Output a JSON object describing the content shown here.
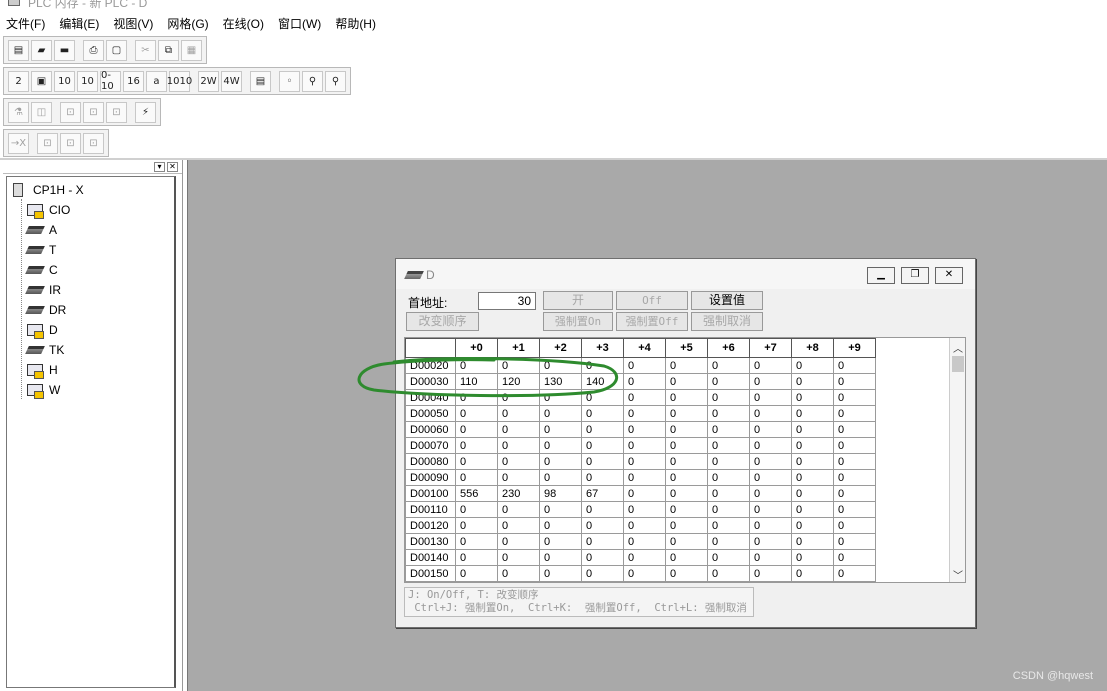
{
  "titlebar": {
    "title": "PLC 内存 - 新 PLC - D"
  },
  "menubar": {
    "items": [
      "文件(F)",
      "编辑(E)",
      "视图(V)",
      "网格(G)",
      "在线(O)",
      "窗口(W)",
      "帮助(H)"
    ]
  },
  "toolbar": {
    "row1": [
      "▤",
      "▰",
      "▬",
      "⎙",
      "▢",
      "✂",
      "⧉",
      "▦"
    ],
    "row2": [
      "2",
      "▣",
      "10",
      "10",
      "0-10",
      "16",
      "a",
      "1010",
      "2W",
      "4W",
      "▤",
      "◦",
      "⚲",
      "⚲"
    ],
    "row3": [
      "⚗",
      "◫",
      "⊡",
      "⊡",
      "⊡",
      "⚡"
    ],
    "row4": [
      "→X",
      "⊡",
      "⊡",
      "⊡"
    ]
  },
  "tree": {
    "root": "CP1H - X",
    "items": [
      {
        "label": "CIO",
        "icon": "memory"
      },
      {
        "label": "A",
        "icon": "chip"
      },
      {
        "label": "T",
        "icon": "chip"
      },
      {
        "label": "C",
        "icon": "chip"
      },
      {
        "label": "IR",
        "icon": "chip"
      },
      {
        "label": "DR",
        "icon": "chip"
      },
      {
        "label": "D",
        "icon": "memory"
      },
      {
        "label": "TK",
        "icon": "chip"
      },
      {
        "label": "H",
        "icon": "memory"
      },
      {
        "label": "W",
        "icon": "memory"
      }
    ]
  },
  "memory_window": {
    "title": "D",
    "start_address_label": "首地址:",
    "start_address_value": "30",
    "buttons": {
      "on": "开",
      "off": "Off",
      "set_value": "设置值",
      "change_order": "改变顺序",
      "force_on": "强制置On",
      "force_off": "强制置Off",
      "force_cancel": "强制取消"
    },
    "columns": [
      "+0",
      "+1",
      "+2",
      "+3",
      "+4",
      "+5",
      "+6",
      "+7",
      "+8",
      "+9"
    ],
    "rows": [
      {
        "addr": "D00020",
        "values": [
          "0",
          "0",
          "0",
          "0",
          "0",
          "0",
          "0",
          "0",
          "0",
          "0"
        ]
      },
      {
        "addr": "D00030",
        "values": [
          "110",
          "120",
          "130",
          "140",
          "0",
          "0",
          "0",
          "0",
          "0",
          "0"
        ]
      },
      {
        "addr": "D00040",
        "values": [
          "0",
          "0",
          "0",
          "0",
          "0",
          "0",
          "0",
          "0",
          "0",
          "0"
        ]
      },
      {
        "addr": "D00050",
        "values": [
          "0",
          "0",
          "0",
          "0",
          "0",
          "0",
          "0",
          "0",
          "0",
          "0"
        ]
      },
      {
        "addr": "D00060",
        "values": [
          "0",
          "0",
          "0",
          "0",
          "0",
          "0",
          "0",
          "0",
          "0",
          "0"
        ]
      },
      {
        "addr": "D00070",
        "values": [
          "0",
          "0",
          "0",
          "0",
          "0",
          "0",
          "0",
          "0",
          "0",
          "0"
        ]
      },
      {
        "addr": "D00080",
        "values": [
          "0",
          "0",
          "0",
          "0",
          "0",
          "0",
          "0",
          "0",
          "0",
          "0"
        ]
      },
      {
        "addr": "D00090",
        "values": [
          "0",
          "0",
          "0",
          "0",
          "0",
          "0",
          "0",
          "0",
          "0",
          "0"
        ]
      },
      {
        "addr": "D00100",
        "values": [
          "556",
          "230",
          "98",
          "67",
          "0",
          "0",
          "0",
          "0",
          "0",
          "0"
        ]
      },
      {
        "addr": "D00110",
        "values": [
          "0",
          "0",
          "0",
          "0",
          "0",
          "0",
          "0",
          "0",
          "0",
          "0"
        ]
      },
      {
        "addr": "D00120",
        "values": [
          "0",
          "0",
          "0",
          "0",
          "0",
          "0",
          "0",
          "0",
          "0",
          "0"
        ]
      },
      {
        "addr": "D00130",
        "values": [
          "0",
          "0",
          "0",
          "0",
          "0",
          "0",
          "0",
          "0",
          "0",
          "0"
        ]
      },
      {
        "addr": "D00140",
        "values": [
          "0",
          "0",
          "0",
          "0",
          "0",
          "0",
          "0",
          "0",
          "0",
          "0"
        ]
      },
      {
        "addr": "D00150",
        "values": [
          "0",
          "0",
          "0",
          "0",
          "0",
          "0",
          "0",
          "0",
          "0",
          "0"
        ]
      }
    ],
    "hint_line1": "J: On/Off,    T: 改变顺序",
    "hint_line2": " Ctrl+J: 强制置On,  Ctrl+K:  强制置Off,  Ctrl+L: 强制取消"
  },
  "watermark": "CSDN @hqwest",
  "colors": {
    "workspace": "#a9a9a9",
    "annotation": "#2e8b2e"
  }
}
